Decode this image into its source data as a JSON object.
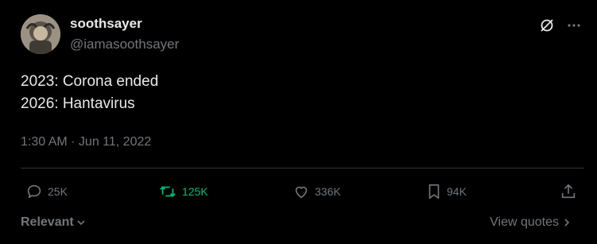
{
  "author": {
    "display_name": "soothsayer",
    "handle": "@iamasoothsayer"
  },
  "post": {
    "lines": [
      "2023: Corona ended",
      "2026: Hantavirus"
    ],
    "timestamp": "1:30 AM · Jun 11, 2022"
  },
  "actions": {
    "replies": "25K",
    "reposts": "125K",
    "likes": "336K",
    "bookmarks": "94K"
  },
  "footer": {
    "sort_label": "Relevant",
    "quotes_label": "View quotes"
  },
  "colors": {
    "background": "#000000",
    "text": "#e7e9ea",
    "muted": "#71767b",
    "repost_active": "#00ba7c",
    "divider": "#2f3336"
  },
  "icons": {
    "reply": "reply-icon",
    "repost": "repost-icon",
    "like": "heart-icon",
    "bookmark": "bookmark-icon",
    "share": "share-icon",
    "grok": "grok-icon",
    "more": "more-icon"
  }
}
